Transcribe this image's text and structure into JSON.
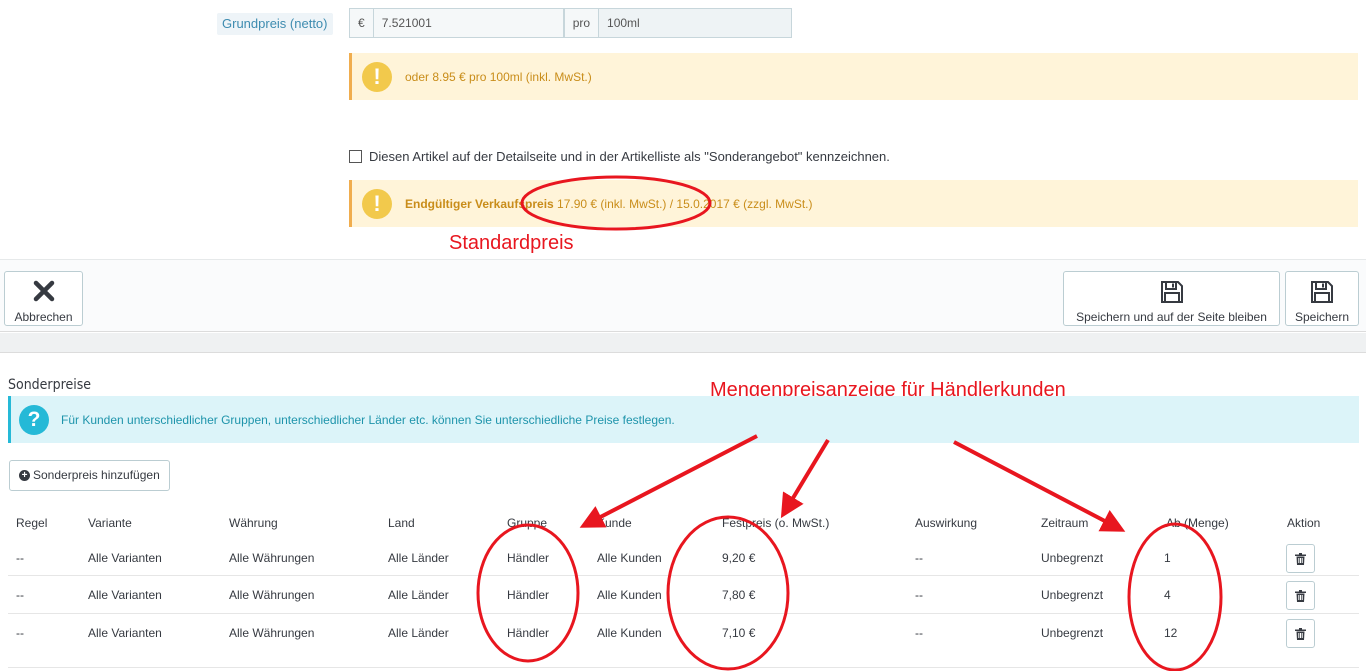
{
  "form": {
    "base_price_label": "Grundpreis (netto)",
    "currency_symbol": "€",
    "base_price_value": "7.521001",
    "per_label": "pro",
    "unit_value": "100ml",
    "unit_price_hint": "oder 8.95 € pro 100ml (inkl. MwSt.)",
    "special_offer_checkbox_label": "Diesen Artikel auf der Detailseite und in der Artikelliste als \"Sonderangebot\" kennzeichnen.",
    "final_price_bold": "Endgültiger Verkaufspreis",
    "final_price_text": " 17.90 € (inkl. MwSt.) / 15.0.2017 € (zzgl. MwSt.)"
  },
  "toolbar": {
    "cancel_label": "Abbrechen",
    "save_stay_label": "Speichern und auf der Seite bleiben",
    "save_label": "Speichern"
  },
  "special_prices": {
    "title": "Sonderpreise",
    "info_text": "Für Kunden unterschiedlicher Gruppen, unterschiedlicher Länder etc. können Sie unterschiedliche Preise festlegen.",
    "add_button_label": "Sonderpreis hinzufügen",
    "columns": [
      "Regel",
      "Variante",
      "Währung",
      "Land",
      "Gruppe",
      "Kunde",
      "Festpreis (o. MwSt.)",
      "Auswirkung",
      "Zeitraum",
      "Ab (Menge)",
      "Aktion"
    ],
    "rows": [
      [
        "--",
        "Alle Varianten",
        "Alle Währungen",
        "Alle Länder",
        "Händler",
        "Alle Kunden",
        "9,20 €",
        "--",
        "Unbegrenzt",
        "1"
      ],
      [
        "--",
        "Alle Varianten",
        "Alle Währungen",
        "Alle Länder",
        "Händler",
        "Alle Kunden",
        "7,80 €",
        "--",
        "Unbegrenzt",
        "4"
      ],
      [
        "--",
        "Alle Varianten",
        "Alle Währungen",
        "Alle Länder",
        "Händler",
        "Alle Kunden",
        "7,10 €",
        "--",
        "Unbegrenzt",
        "12"
      ]
    ]
  },
  "annotations": {
    "standard_price": "Standardpreis",
    "bulk_price": "Mengenpreisanzeige für Händlerkunden",
    "color": "#e8161f"
  },
  "colors": {
    "warning_bg": "#fff4d9",
    "info_bg": "#dcf4f9",
    "accent": "#25b9d7"
  }
}
